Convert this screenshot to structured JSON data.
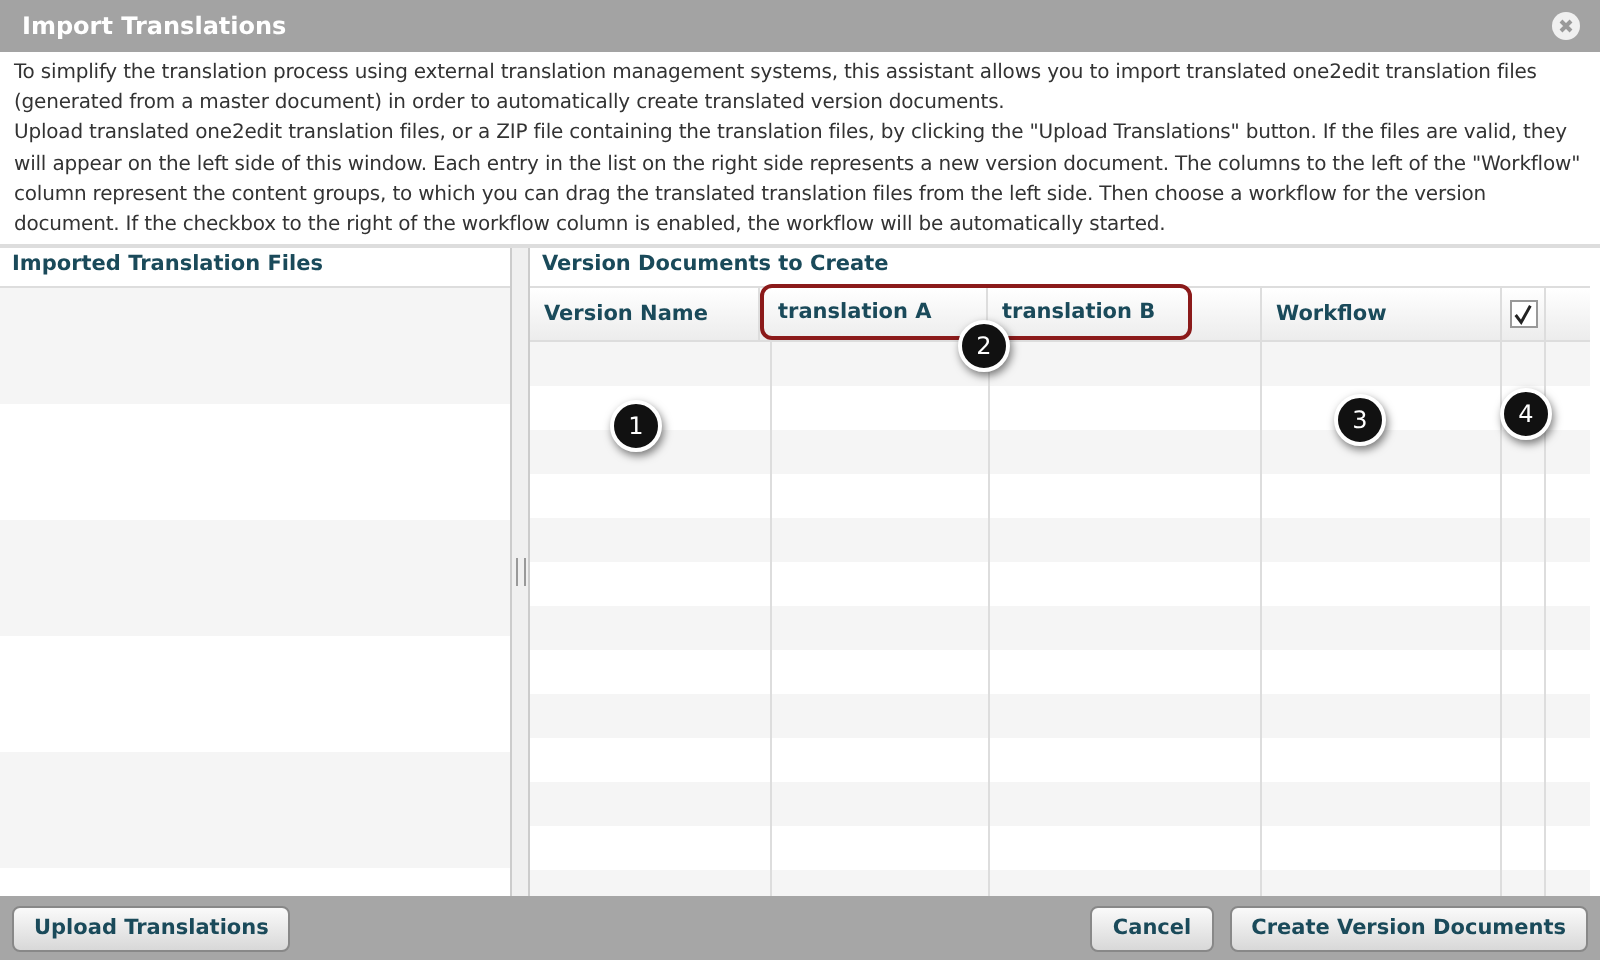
{
  "window": {
    "title": "Import Translations"
  },
  "description": [
    "To simplify the translation process using external translation management systems, this assistant allows you to import translated one2edit translation files (generated from a master document) in order to automatically create translated version documents.",
    "Upload translated one2edit translation files, or a ZIP file containing the translation files, by clicking the \"Upload Translations\" button. If the files are valid, they will appear on the left side of this window. Each entry in the list on the right side represents a new version document. The columns to the left of the \"Workflow\" column represent the content groups, to which you can drag the translated translation files from the left side. Then choose a workflow for the version document. If the checkbox to the right of the workflow column is enabled, the workflow will be automatically started."
  ],
  "left_panel": {
    "title": "Imported Translation Files"
  },
  "right_panel": {
    "title": "Version Documents to Create",
    "columns": [
      {
        "kind": "text",
        "label": "Version Name"
      },
      {
        "kind": "text",
        "label": "translation A"
      },
      {
        "kind": "text",
        "label": "translation B"
      },
      {
        "kind": "text",
        "label": "Workflow"
      },
      {
        "kind": "checkbox",
        "checked": true
      }
    ]
  },
  "callouts": [
    {
      "label": "1"
    },
    {
      "label": "2"
    },
    {
      "label": "3"
    },
    {
      "label": "4"
    }
  ],
  "buttons": {
    "left": [
      "Upload Translations"
    ],
    "right": [
      "Cancel",
      "Create Version Documents"
    ]
  }
}
